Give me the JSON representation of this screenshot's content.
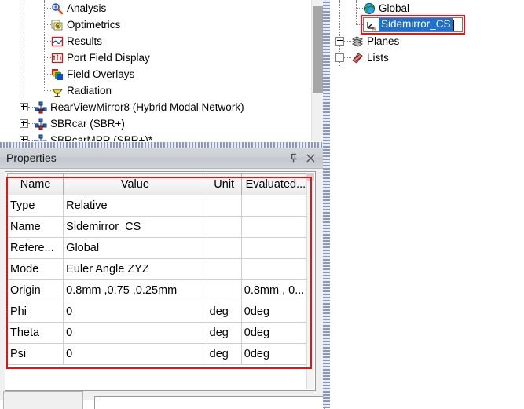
{
  "project_tree": {
    "items": [
      {
        "label": "Analysis",
        "icon": "analysis-icon",
        "indent": 1,
        "expandable": false
      },
      {
        "label": "Optimetrics",
        "icon": "optimetrics-icon",
        "indent": 1,
        "expandable": false
      },
      {
        "label": "Results",
        "icon": "results-icon",
        "indent": 1,
        "expandable": false
      },
      {
        "label": "Port Field Display",
        "icon": "port-field-display-icon",
        "indent": 1,
        "expandable": false
      },
      {
        "label": "Field Overlays",
        "icon": "field-overlays-icon",
        "indent": 1,
        "expandable": false
      },
      {
        "label": "Radiation",
        "icon": "radiation-icon",
        "indent": 1,
        "expandable": false
      },
      {
        "label": "RearViewMirror8 (Hybrid Modal Network)",
        "icon": "design-icon",
        "indent": 0,
        "expandable": true
      },
      {
        "label": "SBRcar (SBR+)",
        "icon": "design-icon",
        "indent": 0,
        "expandable": true
      },
      {
        "label": "SBRcarMPR (SBR+)*",
        "icon": "design-icon",
        "indent": 0,
        "expandable": true
      }
    ]
  },
  "properties": {
    "title": "Properties",
    "pin_icon": "pin-icon",
    "close_icon": "close-icon",
    "columns": [
      "Name",
      "Value",
      "Unit",
      "Evaluated..."
    ],
    "rows": [
      {
        "name": "Type",
        "value": "Relative",
        "unit": "",
        "evaluated": ""
      },
      {
        "name": "Name",
        "value": "Sidemirror_CS",
        "unit": "",
        "evaluated": ""
      },
      {
        "name": "Refere...",
        "value": "Global",
        "unit": "",
        "evaluated": ""
      },
      {
        "name": "Mode",
        "value": "Euler Angle ZYZ",
        "unit": "",
        "evaluated": ""
      },
      {
        "name": "Origin",
        "value": "0.8mm ,0.75 ,0.25mm",
        "unit": "",
        "evaluated": "0.8mm , 0..."
      },
      {
        "name": "Phi",
        "value": "0",
        "unit": "deg",
        "evaluated": "0deg"
      },
      {
        "name": "Theta",
        "value": "0",
        "unit": "deg",
        "evaluated": "0deg"
      },
      {
        "name": "Psi",
        "value": "0",
        "unit": "deg",
        "evaluated": "0deg"
      }
    ]
  },
  "coordinate_tree": {
    "items": [
      {
        "label": "Global",
        "icon": "globe-icon",
        "indent": 1,
        "expandable": false,
        "editing": false
      },
      {
        "label": "Sidemirror_CS",
        "icon": "coordinate-system-icon",
        "indent": 1,
        "expandable": false,
        "editing": true
      },
      {
        "label": "Planes",
        "icon": "planes-icon",
        "indent": 0,
        "expandable": true,
        "editing": false
      },
      {
        "label": "Lists",
        "icon": "lists-icon",
        "indent": 0,
        "expandable": true,
        "editing": false
      }
    ]
  },
  "colors": {
    "annotation": "#ee1111",
    "selection": "#1d6fd0",
    "titlebar": "#cbcfd5"
  }
}
